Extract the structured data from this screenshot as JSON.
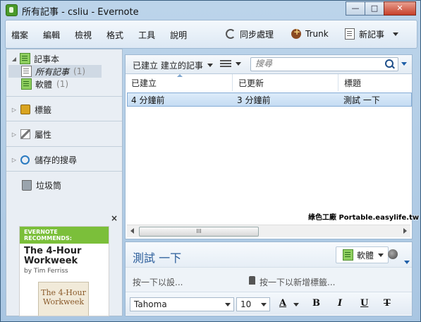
{
  "window": {
    "title": "所有記事 - csliu - Evernote",
    "min": "—",
    "max": "□",
    "close": "✕"
  },
  "menu": [
    "檔案",
    "編輯",
    "檢視",
    "格式",
    "工具",
    "說明"
  ],
  "toolbar": {
    "sync": "同步處理",
    "trunk": "Trunk",
    "new_note": "新記事"
  },
  "sidebar": {
    "notebooks_header": "記事本",
    "notebooks": [
      {
        "label": "所有記事",
        "count": "(1)"
      },
      {
        "label": "軟體",
        "count": "(1)"
      }
    ],
    "tags": "標籤",
    "attributes": "屬性",
    "saved_searches": "儲存的搜尋",
    "trash": "垃圾筒"
  },
  "ad": {
    "close": "×",
    "line1": "EVERNOTE",
    "line2": "RECOMMENDS:",
    "book": "The 4-Hour Workweek",
    "author": "by Tim Ferriss",
    "cover": "The 4-Hour Workweek"
  },
  "list": {
    "view_label": "已建立 建立的記事",
    "search_placeholder": "搜尋",
    "columns": [
      "已建立",
      "已更新",
      "標題"
    ],
    "rows": [
      {
        "created": "4 分鐘前",
        "updated": "3 分鐘前",
        "title": "測試 一下"
      }
    ],
    "scroll_grip": "III"
  },
  "watermark": "綠色工廠 Portable.easylife.tw",
  "note": {
    "title": "測試 一下",
    "notebook": "軟體",
    "source_placeholder": "按一下以設...",
    "tags_placeholder": "按一下以新增標籤...",
    "font": "Tahoma",
    "size": "10",
    "font_color": "A",
    "bold": "B",
    "italic": "I",
    "underline": "U",
    "strike": "T"
  }
}
